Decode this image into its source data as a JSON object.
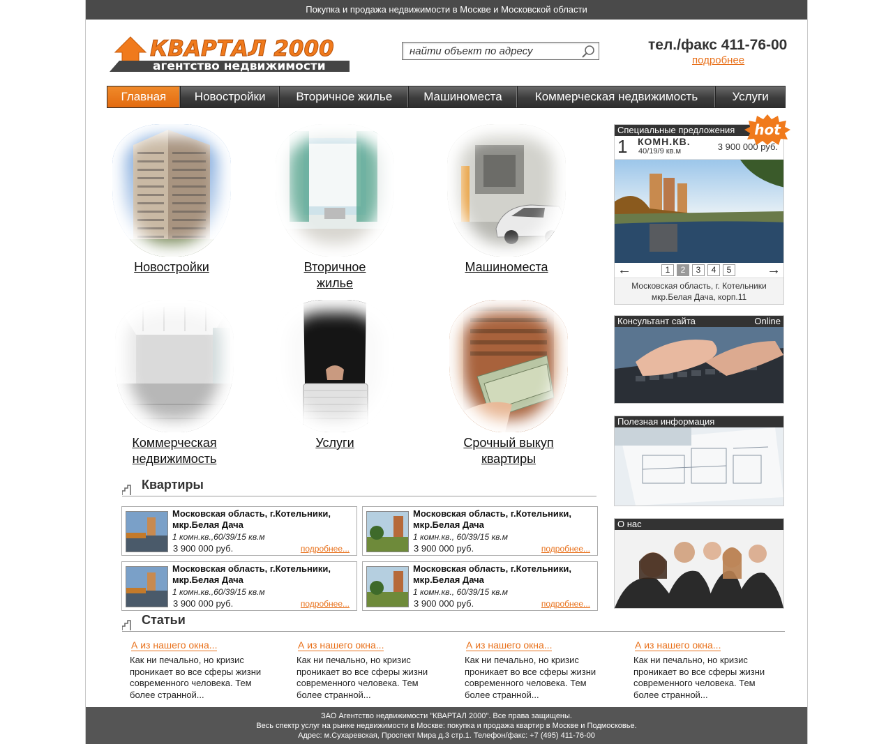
{
  "topbar": {
    "text": "Покупка и продажа недвижимости в Москве и Московской области"
  },
  "header": {
    "logo_name": "КВАРТАЛ 2000",
    "logo_tagline": "агентство недвижимости",
    "search_placeholder": "найти объект по адресу",
    "phone": "тел./факс 411-76-00",
    "more": "подробнее"
  },
  "nav": [
    {
      "label": "Главная",
      "active": true
    },
    {
      "label": "Новостройки"
    },
    {
      "label": "Вторичное жилье"
    },
    {
      "label": "Машиноместа"
    },
    {
      "label": "Коммерческая недвижимость"
    },
    {
      "label": "Услуги"
    }
  ],
  "categories": [
    {
      "label": "Новостройки"
    },
    {
      "label_line1": "Вторичное",
      "label_line2": "жилье"
    },
    {
      "label": "Машиноместа"
    },
    {
      "label_line1": "Коммерческая",
      "label_line2": "недвижимость"
    },
    {
      "label": "Услуги"
    },
    {
      "label_line1": "Срочный выкуп",
      "label_line2": "квартиры"
    }
  ],
  "apartments": {
    "heading": "Квартиры",
    "items": [
      {
        "addr1": "Московская область, г.Котельники,",
        "addr2": "мкр.Белая Дача",
        "size": "1 комн.кв.,60/39/15 кв.м",
        "price": "3 900 000 руб.",
        "more": "подробнее..."
      },
      {
        "addr1": "Московская область, г.Котельники,",
        "addr2": "мкр.Белая Дача",
        "size": "1 комн.кв., 60/39/15 кв.м",
        "price": "3 900 000 руб.",
        "more": "подробнее..."
      },
      {
        "addr1": "Московская область, г.Котельники,",
        "addr2": "мкр.Белая Дача",
        "size": "1 комн.кв.,60/39/15 кв.м",
        "price": "3 900 000 руб.",
        "more": "подробнее..."
      },
      {
        "addr1": "Московская область, г.Котельники,",
        "addr2": "мкр.Белая Дача",
        "size": "1 комн.кв., 60/39/15 кв.м",
        "price": "3 900 000 руб.",
        "more": "подробнее..."
      }
    ]
  },
  "articles": {
    "heading": "Статьи",
    "items": [
      {
        "title": "А из нашего окна...",
        "text": "Как ни печально, но кризис проникает во все сферы жизни современного человека. Тем более странной..."
      },
      {
        "title": "А из нашего окна...",
        "text": "Как ни печально, но кризис проникает во все сферы жизни современного человека. Тем более странной..."
      },
      {
        "title": "А из нашего окна...",
        "text": "Как ни печально, но кризис проникает во все сферы жизни современного человека. Тем более странной..."
      },
      {
        "title": "А из нашего окна...",
        "text": "Как ни печально, но кризис проникает во все сферы жизни современного человека. Тем более странной..."
      }
    ]
  },
  "sidebar": {
    "special": {
      "title": "Специальные предложения",
      "hot": "hot",
      "rooms": "1",
      "type": "КОМН.КВ.",
      "area": "40/19/9 кв.м",
      "price": "3 900 000 руб.",
      "pages": [
        "1",
        "2",
        "3",
        "4",
        "5"
      ],
      "current_page": "2",
      "addr_line1": "Московская область, г. Котельники",
      "addr_line2": "мкр.Белая Дача, корп.11"
    },
    "consultant": {
      "title": "Консультант сайта",
      "status": "Online"
    },
    "info": {
      "title": "Полезная информация"
    },
    "about": {
      "title": "О нас"
    }
  },
  "footer": {
    "line1": "ЗАО Агентство недвижимости \"КВАРТАЛ 2000\". Все права защищены.",
    "line2": "Весь спектр услуг на рынке недвижимости в Москве: покупка и продажа квартир в Москве и Подмосковье.",
    "line3": "Адрес: м.Сухаревская, Проспект Мира д.3 стр.1. Телефон/факс: +7 (495) 411-76-00"
  },
  "colors": {
    "accent": "#e8701a",
    "dark_bar": "#333333",
    "footer": "#555555"
  }
}
